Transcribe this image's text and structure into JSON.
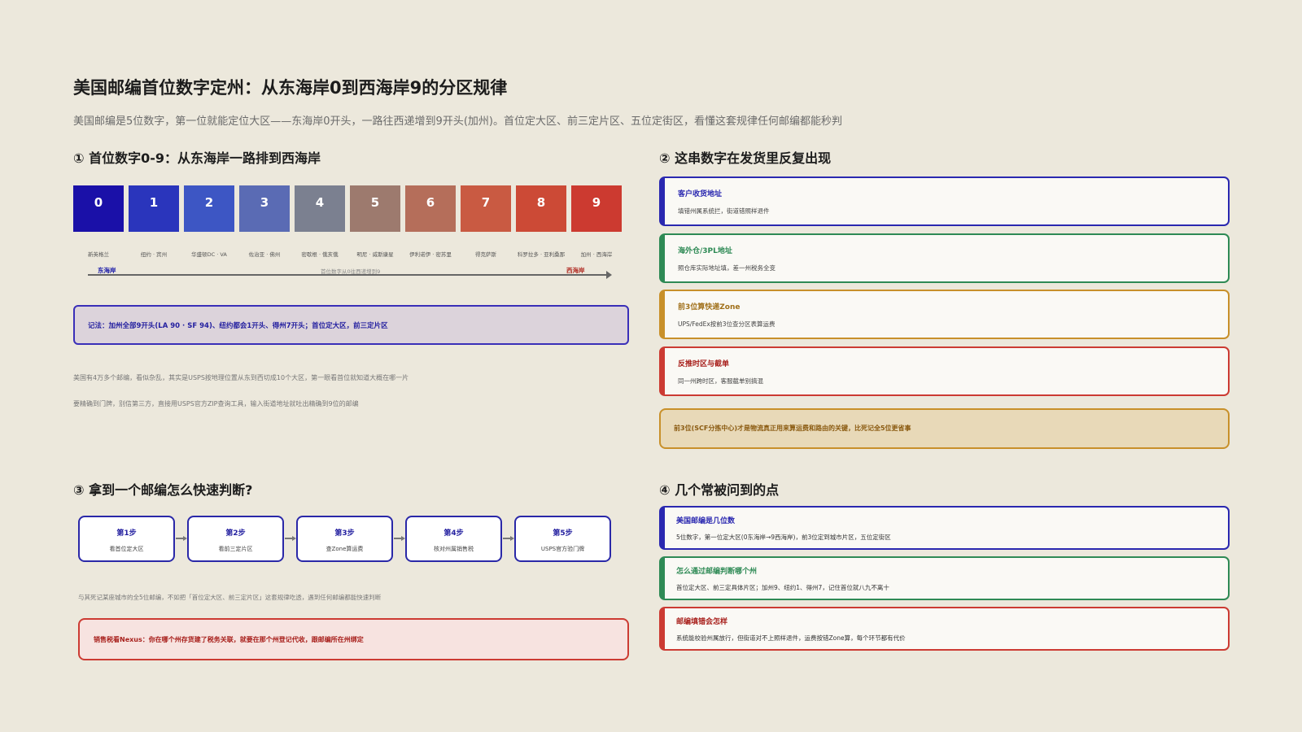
{
  "header": {
    "title": "美国邮编首位数字定州：从东海岸0到西海岸9的分区规律",
    "subtitle": "美国邮编是5位数字，第一位就能定位大区——东海岸0开头，一路往西递增到9开头(加州)。首位定大区、前三定片区、五位定街区，看懂这套规律任何邮编都能秒判"
  },
  "section1": {
    "heading": "① 首位数字0-9：从东海岸一路排到西海岸",
    "digits": [
      {
        "digit": "0",
        "label": "新英格兰",
        "color": "#1a10a8"
      },
      {
        "digit": "1",
        "label": "纽约 · 宾州",
        "color": "#2a35bc"
      },
      {
        "digit": "2",
        "label": "华盛顿DC · VA",
        "color": "#3d56c4"
      },
      {
        "digit": "3",
        "label": "佐治亚 · 佛州",
        "color": "#5a6bb4"
      },
      {
        "digit": "4",
        "label": "密歇根 · 俄亥俄",
        "color": "#7b8090"
      },
      {
        "digit": "5",
        "label": "明尼 · 威斯康星",
        "color": "#9d7a6e"
      },
      {
        "digit": "6",
        "label": "伊利诺伊 · 密苏里",
        "color": "#b56e5a"
      },
      {
        "digit": "7",
        "label": "得克萨斯",
        "color": "#c95a42"
      },
      {
        "digit": "8",
        "label": "科罗拉多 · 亚利桑那",
        "color": "#cc4a36"
      },
      {
        "digit": "9",
        "label": "加州 · 西海岸",
        "color": "#cc3a30"
      }
    ],
    "axis_east": "东海岸",
    "axis_mid": "首位数字从0往西递增到9",
    "axis_west": "西海岸",
    "mnemonic": "记法：加州全部9开头(LA 90 · SF 94)、纽约都会1开头、得州7开头；首位定大区，前三定片区",
    "note1": "美国有4万多个邮编，看似杂乱，其实是USPS按地理位置从东到西切成10个大区，第一眼看首位就知道大概在哪一片",
    "note2": "要精确到门牌，别信第三方，直接用USPS官方ZIP查询工具，输入街道地址就吐出精确到9位的邮编"
  },
  "section2": {
    "heading": "② 这串数字在发货里反复出现",
    "cards": [
      {
        "title": "客户收货地址",
        "sub": "填错州属系统拦，街道错照样退件",
        "color": "#2a28b0"
      },
      {
        "title": "海外仓/3PL地址",
        "sub": "照仓库实际地址填，差一州税务全变",
        "color": "#2e8a55"
      },
      {
        "title": "前3位算快递Zone",
        "sub": "UPS/FedEx按前3位查分区表算运费",
        "color": "#c8902a"
      },
      {
        "title": "反推时区与截单",
        "sub": "同一州跨时区，客服截单别搞混",
        "color": "#cc3b33"
      }
    ],
    "warning": "前3位(SCF分拣中心)才是物流真正用来算运费和路由的关键，比死记全5位更省事"
  },
  "section3": {
    "heading": "③ 拿到一个邮编怎么快速判断?",
    "steps": [
      {
        "title": "第1步",
        "sub": "看首位定大区"
      },
      {
        "title": "第2步",
        "sub": "看前三定片区"
      },
      {
        "title": "第3步",
        "sub": "查Zone算运费"
      },
      {
        "title": "第4步",
        "sub": "核对州属销售税"
      },
      {
        "title": "第5步",
        "sub": "USPS官方验门牌"
      }
    ],
    "note": "与其死记某座城市的全5位邮编，不如把「首位定大区、前三定片区」这套规律吃透，遇到任何邮编都能快速判断",
    "nexus": "销售税看Nexus：你在哪个州存货建了税务关联，就要在那个州登记代收，跟邮编所在州绑定"
  },
  "section4": {
    "heading": "④ 几个常被问到的点",
    "faqs": [
      {
        "q": "美国邮编是几位数",
        "a": "5位数字，第一位定大区(0东海岸→9西海岸)，前3位定到城市片区，五位定街区",
        "color": "#2a28b0"
      },
      {
        "q": "怎么通过邮编判断哪个州",
        "a": "首位定大区、前三定具体片区；加州9、纽约1、得州7，记住首位就八九不离十",
        "color": "#2e8a55"
      },
      {
        "q": "邮编填错会怎样",
        "a": "系统能校验州属放行，但街道对不上照样退件，运费按错Zone算，每个环节都有代价",
        "color": "#cc3b33"
      }
    ]
  }
}
